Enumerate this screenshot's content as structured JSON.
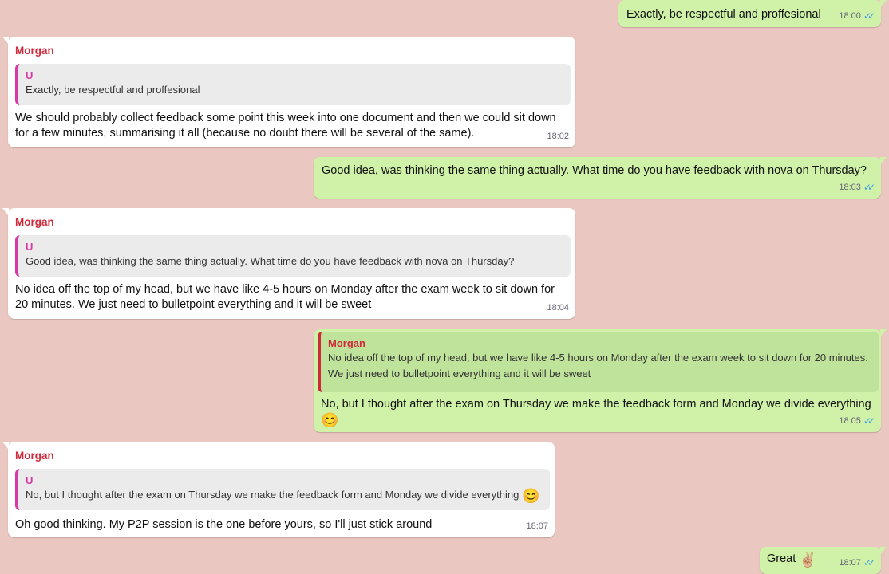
{
  "colors": {
    "background": "#ebc7c1",
    "incoming_bubble": "#ffffff",
    "outgoing_bubble": "#d0f2a8",
    "sender_name": "#d0293a",
    "quote_bar_pink": "#d63aa6",
    "read_ticks": "#3b9be8"
  },
  "icons": {
    "read_receipt": "double-check-icon"
  },
  "messages": [
    {
      "type": "outgoing",
      "text": "Exactly, be respectful and proffesional",
      "time": "18:00"
    },
    {
      "type": "incoming",
      "sender": "Morgan",
      "quote": {
        "author": "U",
        "text": "Exactly, be respectful and proffesional"
      },
      "text": "We should probably collect feedback some point this week into one document and then we could sit down for a few minutes, summarising it all (because no doubt there will be several of the same).",
      "time": "18:02"
    },
    {
      "type": "outgoing",
      "text": "Good idea, was thinking the same thing actually. What time do you have feedback with nova on Thursday?",
      "time": "18:03"
    },
    {
      "type": "incoming",
      "sender": "Morgan",
      "quote": {
        "author": "U",
        "text": "Good idea, was thinking the same thing actually. What time do you have feedback with nova on Thursday?"
      },
      "text": "No idea off the top of my head, but we have like 4-5 hours on Monday after the exam week to sit down for 20 minutes. We just need to bulletpoint everything and it will be sweet",
      "time": "18:04"
    },
    {
      "type": "outgoing",
      "quote": {
        "author": "Morgan",
        "text": "No idea off the top of my head, but we have like 4-5 hours on Monday after the exam week to sit down for 20 minutes. We just need to bulletpoint everything and it will be sweet"
      },
      "text": "No, but I thought after the exam on Thursday we make the feedback form and Monday we divide everything",
      "emoji": "😊",
      "time": "18:05"
    },
    {
      "type": "incoming",
      "sender": "Morgan",
      "quote": {
        "author": "U",
        "text": "No, but I thought after the exam on Thursday we make the feedback form and Monday we divide everything",
        "emoji": "😊"
      },
      "text": "Oh good thinking. My P2P session is the one before yours, so I'll just stick around",
      "time": "18:07"
    },
    {
      "type": "outgoing",
      "text": "Great",
      "emoji": "✌🏼",
      "time": "18:07"
    }
  ]
}
